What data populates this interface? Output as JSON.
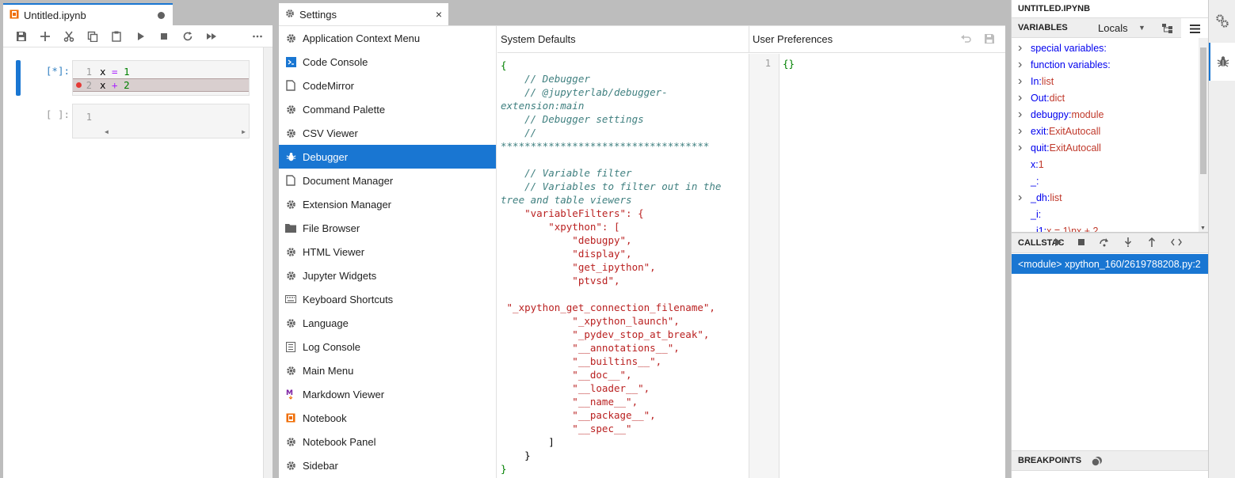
{
  "notebook": {
    "tab_title": "Untitled.ipynb",
    "toolbar": [
      "save-icon",
      "add-cell-icon",
      "cut-icon",
      "copy-icon",
      "paste-icon",
      "run-icon",
      "stop-icon",
      "restart-icon",
      "fast-forward-icon",
      "more-icon"
    ],
    "cells": [
      {
        "prompt": "[*]:",
        "lines": [
          {
            "n": "1",
            "code": [
              "x",
              " = ",
              "1"
            ]
          },
          {
            "n": "2",
            "code": [
              "x",
              " + ",
              "2"
            ]
          }
        ]
      },
      {
        "prompt": "[ ]:",
        "lines": [
          {
            "n": "1",
            "code": ""
          }
        ]
      }
    ]
  },
  "settings": {
    "tab_title": "Settings",
    "close": "×",
    "plugins": [
      "Application Context Menu",
      "Code Console",
      "CodeMirror",
      "Command Palette",
      "CSV Viewer",
      "Debugger",
      "Document Manager",
      "Extension Manager",
      "File Browser",
      "HTML Viewer",
      "Jupyter Widgets",
      "Keyboard Shortcuts",
      "Language",
      "Log Console",
      "Main Menu",
      "Markdown Viewer",
      "Notebook",
      "Notebook Panel",
      "Sidebar"
    ],
    "selected_plugin": "Debugger",
    "system_defaults_label": "System Defaults",
    "user_preferences_label": "User Preferences",
    "user_line_number": "1",
    "user_value": "{}"
  },
  "system_code": [
    {
      "t": "brk",
      "s": "{"
    },
    {
      "t": "cm",
      "s": "    // Debugger"
    },
    {
      "t": "cm",
      "s": "    // @jupyterlab/debugger-"
    },
    {
      "t": "cm",
      "s": "extension:main"
    },
    {
      "t": "cm",
      "s": "    // Debugger settings"
    },
    {
      "t": "cm",
      "s": "    //"
    },
    {
      "t": "cm",
      "s": "***********************************"
    },
    {
      "t": "",
      "s": ""
    },
    {
      "t": "cm",
      "s": "    // Variable filter"
    },
    {
      "t": "cm",
      "s": "    // Variables to filter out in the"
    },
    {
      "t": "cm",
      "s": "tree and table viewers"
    },
    {
      "t": "prop",
      "s": "    \"variableFilters\": {"
    },
    {
      "t": "prop",
      "s": "        \"xpython\": ["
    },
    {
      "t": "str",
      "s": "            \"debugpy\","
    },
    {
      "t": "str",
      "s": "            \"display\","
    },
    {
      "t": "str",
      "s": "            \"get_ipython\","
    },
    {
      "t": "str",
      "s": "            \"ptvsd\","
    },
    {
      "t": "",
      "s": ""
    },
    {
      "t": "str",
      "s": " \"_xpython_get_connection_filename\","
    },
    {
      "t": "str",
      "s": "            \"_xpython_launch\","
    },
    {
      "t": "str",
      "s": "            \"_pydev_stop_at_break\","
    },
    {
      "t": "str",
      "s": "            \"__annotations__\","
    },
    {
      "t": "str",
      "s": "            \"__builtins__\","
    },
    {
      "t": "str",
      "s": "            \"__doc__\","
    },
    {
      "t": "str",
      "s": "            \"__loader__\","
    },
    {
      "t": "str",
      "s": "            \"__name__\","
    },
    {
      "t": "str",
      "s": "            \"__package__\","
    },
    {
      "t": "str",
      "s": "            \"__spec__\""
    },
    {
      "t": "punc",
      "s": "        ]"
    },
    {
      "t": "punc",
      "s": "    }"
    },
    {
      "t": "brk",
      "s": "}"
    }
  ],
  "debugger": {
    "title": "UNTITLED.IPYNB",
    "variables_label": "VARIABLES",
    "scope": "Locals",
    "variables": [
      {
        "expand": true,
        "name": "special variables:",
        "value": ""
      },
      {
        "expand": true,
        "name": "function variables:",
        "value": ""
      },
      {
        "expand": true,
        "name": "In:",
        "value": "list"
      },
      {
        "expand": true,
        "name": "Out:",
        "value": "dict"
      },
      {
        "expand": true,
        "name": "debugpy:",
        "value": "module"
      },
      {
        "expand": true,
        "name": "exit:",
        "value": "ExitAutocall"
      },
      {
        "expand": true,
        "name": "quit:",
        "value": "ExitAutocall"
      },
      {
        "expand": false,
        "name": "x:",
        "value": "1"
      },
      {
        "expand": false,
        "name": "_:",
        "value": ""
      },
      {
        "expand": true,
        "name": "_dh:",
        "value": "list"
      },
      {
        "expand": false,
        "name": "_i:",
        "value": ""
      },
      {
        "expand": false,
        "name": "_i1:",
        "value": "x = 1\\nx + 2"
      }
    ],
    "callstack_label": "CALLSTAC",
    "frame": "<module> xpython_160/2619788208.py:2",
    "breakpoints_label": "BREAKPOINTS"
  }
}
